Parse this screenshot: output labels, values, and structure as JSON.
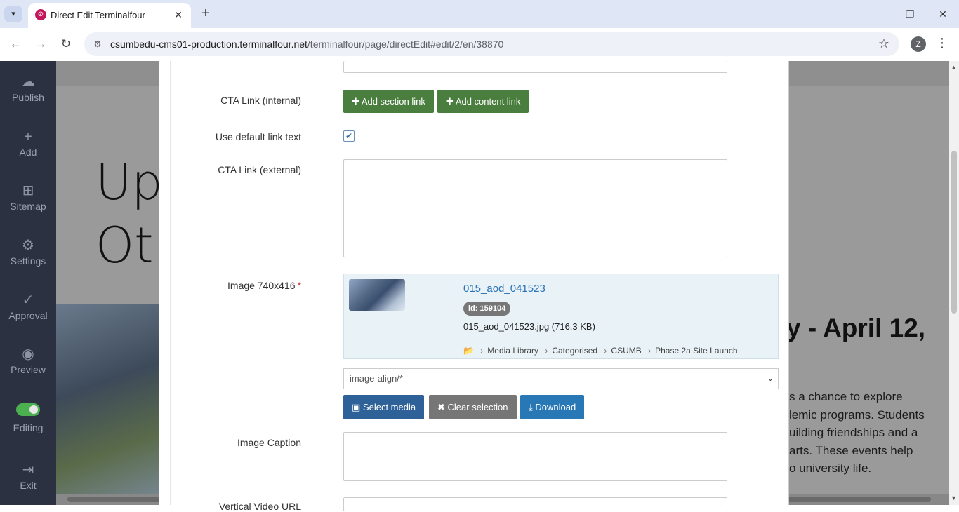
{
  "browser": {
    "tab_title": "Direct Edit Terminalfour",
    "url_host": "csumbedu-cms01-production.terminalfour.net",
    "url_path": "/terminalfour/page/directEdit#edit/2/en/38870",
    "profile_initial": "Z"
  },
  "sidebar": {
    "publish": "Publish",
    "add": "Add",
    "sitemap": "Sitemap",
    "settings": "Settings",
    "approval": "Approval",
    "preview": "Preview",
    "editing": "Editing",
    "exit": "Exit"
  },
  "background_page": {
    "big_text_line1": "Up",
    "big_text_line2": "Ot",
    "right_title": "y - April 12,",
    "para_line1": "s a chance to explore",
    "para_line2": "lemic programs. Students",
    "para_line3": "uilding friendships and a",
    "para_line4": "arts. These events help",
    "para_line5": "o university life."
  },
  "form": {
    "cta_internal_label": "CTA Link (internal)",
    "add_section_link": "Add section link",
    "add_content_link": "Add content link",
    "default_link_text_label": "Use default link text",
    "default_link_text_checked": true,
    "cta_external_label": "CTA Link (external)",
    "image_label": "Image 740x416",
    "image_required_mark": "*",
    "media": {
      "title": "015_aod_041523",
      "id_badge": "id: 159104",
      "file_info": "015_aod_041523.jpg (716.3 KB)",
      "path": [
        "Media Library",
        "Categorised",
        "CSUMB",
        "Phase 2a Site Launch"
      ]
    },
    "image_align_value": "image-align/*",
    "select_media": "Select media",
    "clear_selection": "Clear selection",
    "download": "Download",
    "caption_label": "Image Caption",
    "next_label": "Vertical Video URL"
  }
}
